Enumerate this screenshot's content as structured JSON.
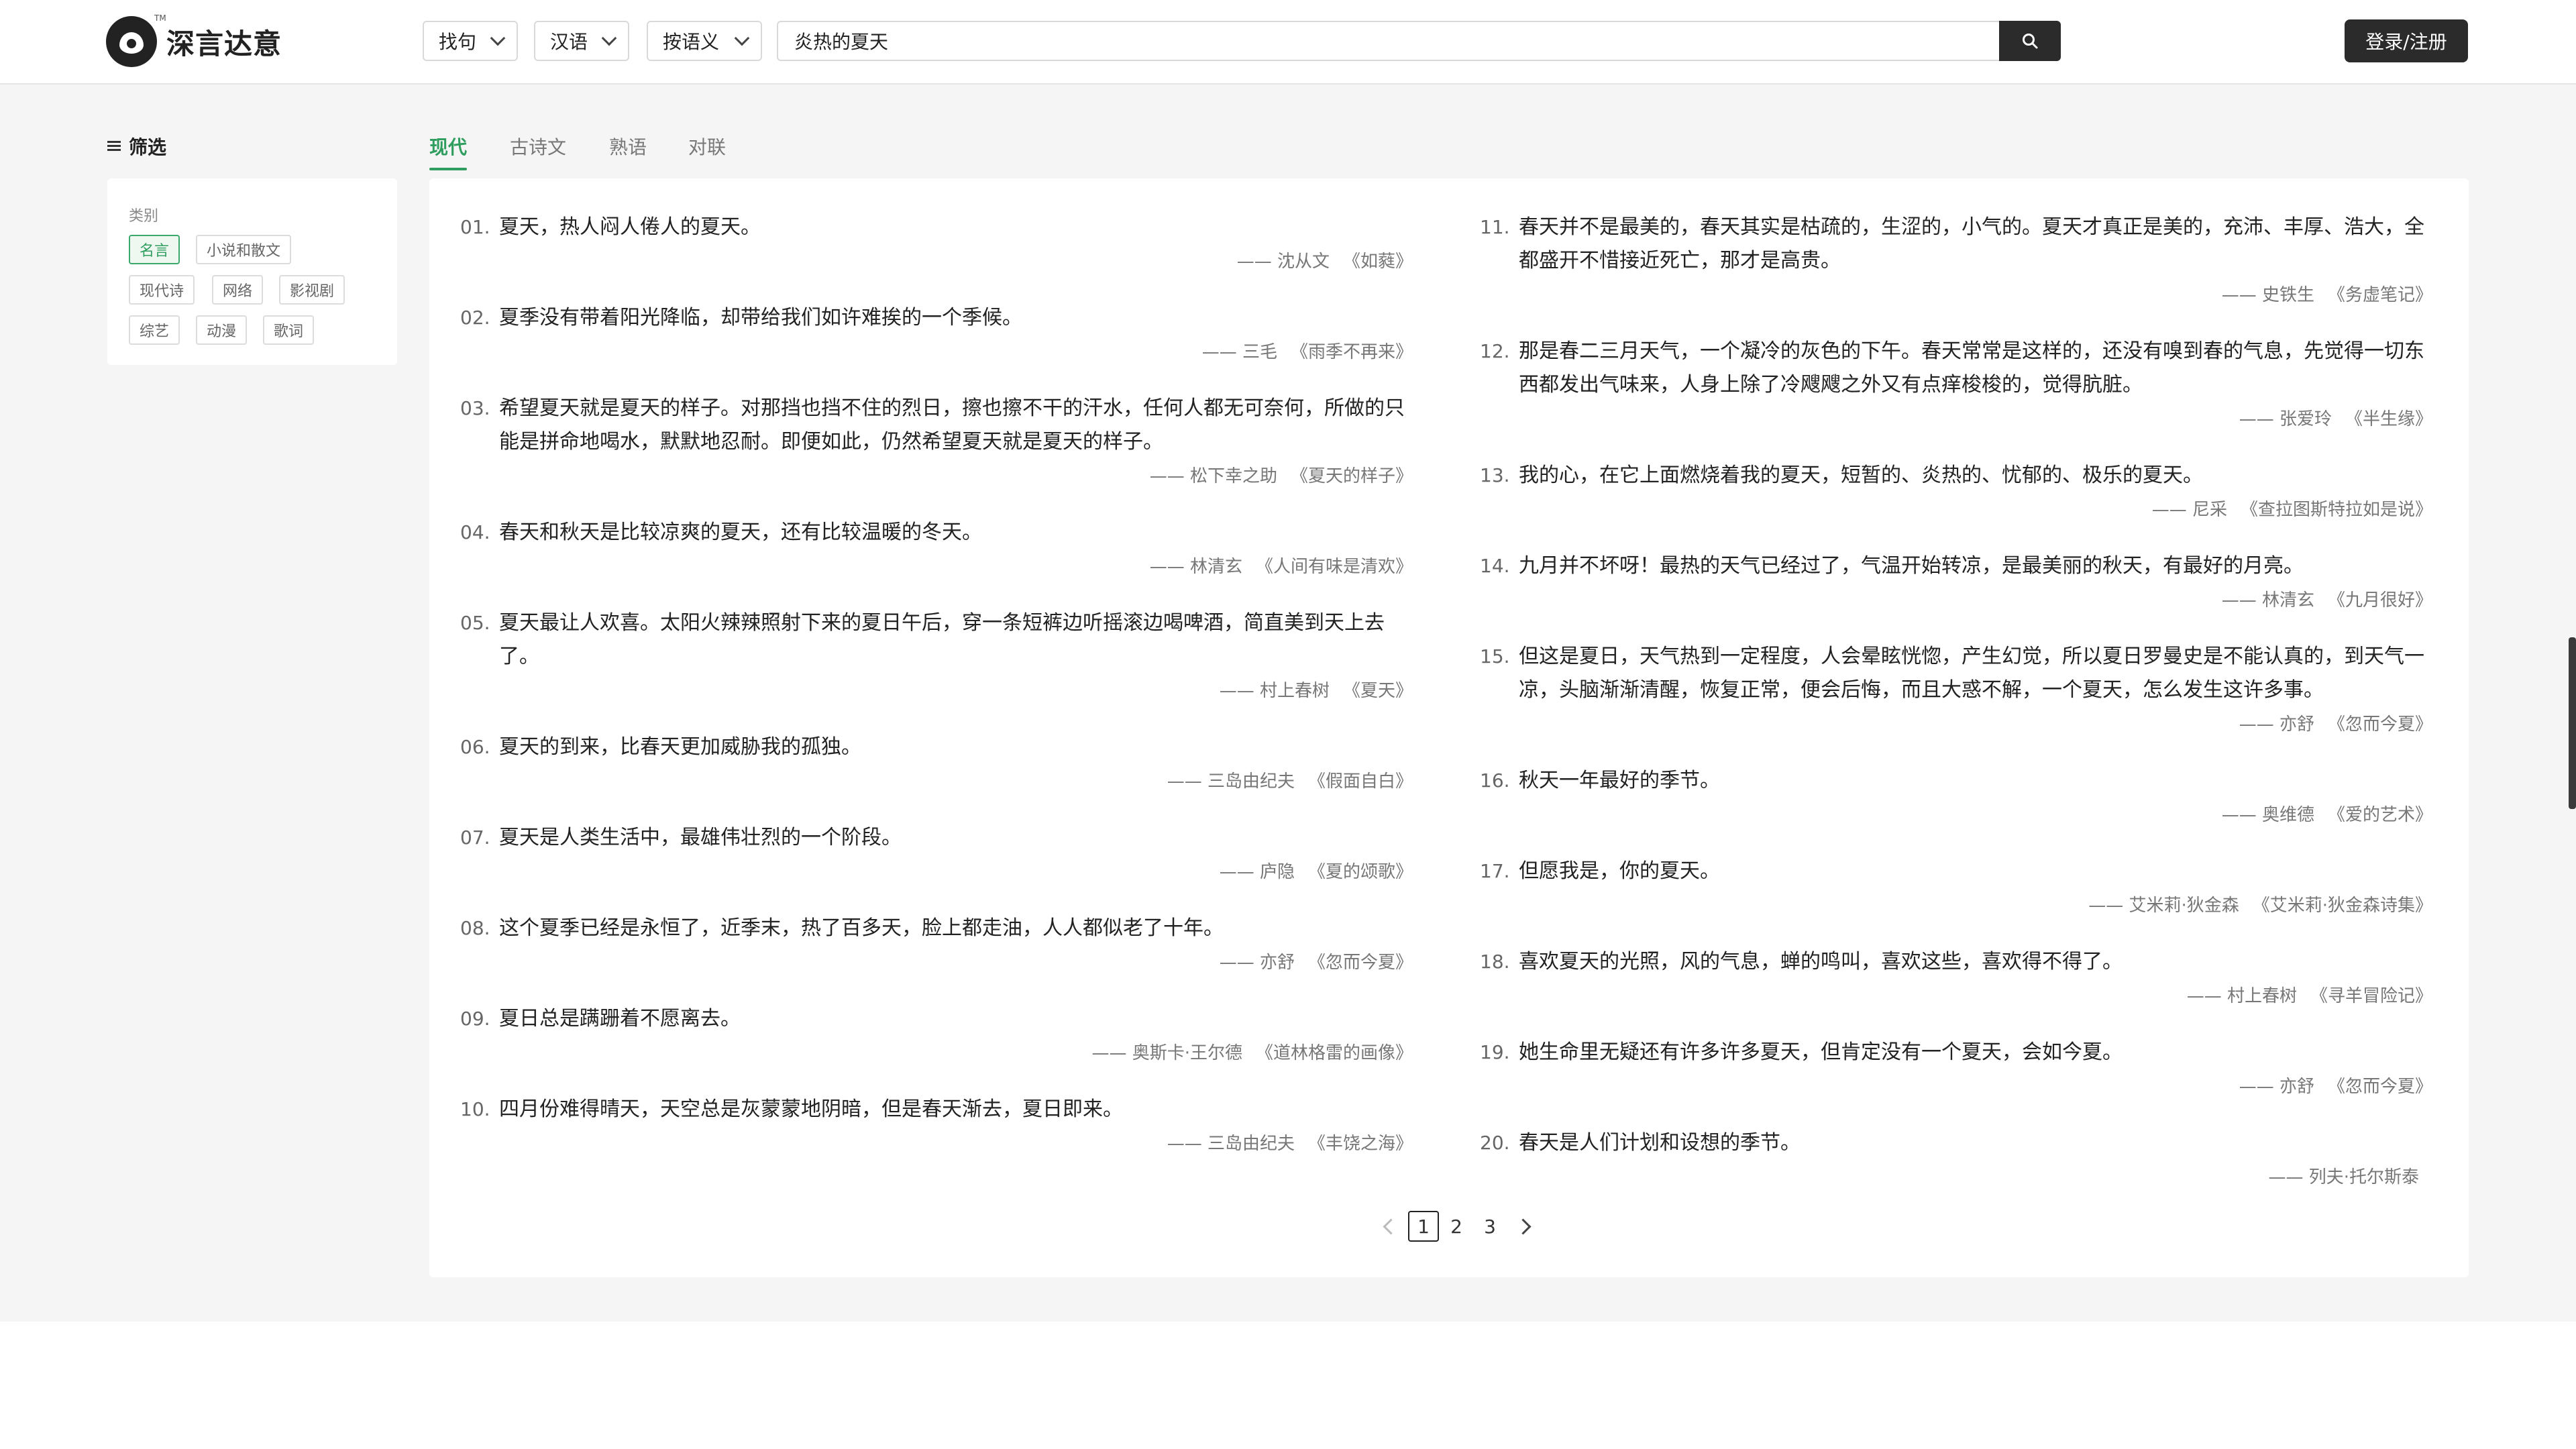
{
  "brand": {
    "name": "深言达意",
    "tm": "TM"
  },
  "header": {
    "mode_dropdown": "找句",
    "language_dropdown": "汉语",
    "method_dropdown": "按语义",
    "search_value": "炎热的夏天",
    "search_placeholder": "",
    "login_label": "登录/注册"
  },
  "sidebar": {
    "filter_title": "筛选",
    "category_label": "类别",
    "tags": [
      "名言",
      "小说和散文",
      "现代诗",
      "网络",
      "影视剧",
      "综艺",
      "动漫",
      "歌词"
    ],
    "active_tag": "名言"
  },
  "tabs": [
    "现代",
    "古诗文",
    "熟语",
    "对联"
  ],
  "active_tab": "现代",
  "quotes": [
    {
      "num": "01.",
      "text": "夏天，热人闷人倦人的夏天。",
      "author": "—— 沈从文",
      "book": "《如蕤》"
    },
    {
      "num": "02.",
      "text": "夏季没有带着阳光降临，却带给我们如许难挨的一个季候。",
      "author": "—— 三毛",
      "book": "《雨季不再来》"
    },
    {
      "num": "03.",
      "text": "希望夏天就是夏天的样子。对那挡也挡不住的烈日，擦也擦不干的汗水，任何人都无可奈何，所做的只能是拼命地喝水，默默地忍耐。即便如此，仍然希望夏天就是夏天的样子。",
      "author": "—— 松下幸之助",
      "book": "《夏天的样子》"
    },
    {
      "num": "04.",
      "text": "春天和秋天是比较凉爽的夏天，还有比较温暖的冬天。",
      "author": "—— 林清玄",
      "book": "《人间有味是清欢》"
    },
    {
      "num": "05.",
      "text": "夏天最让人欢喜。太阳火辣辣照射下来的夏日午后，穿一条短裤边听摇滚边喝啤酒，简直美到天上去了。",
      "author": "—— 村上春树",
      "book": "《夏天》"
    },
    {
      "num": "06.",
      "text": "夏天的到来，比春天更加威胁我的孤独。",
      "author": "—— 三岛由纪夫",
      "book": "《假面自白》"
    },
    {
      "num": "07.",
      "text": "夏天是人类生活中，最雄伟壮烈的一个阶段。",
      "author": "—— 庐隐",
      "book": "《夏的颂歌》"
    },
    {
      "num": "08.",
      "text": "这个夏季已经是永恒了，近季末，热了百多天，脸上都走油，人人都似老了十年。",
      "author": "—— 亦舒",
      "book": "《忽而今夏》"
    },
    {
      "num": "09.",
      "text": "夏日总是蹒跚着不愿离去。",
      "author": "—— 奥斯卡·王尔德",
      "book": "《道林格雷的画像》"
    },
    {
      "num": "10.",
      "text": "四月份难得晴天，天空总是灰蒙蒙地阴暗，但是春天渐去，夏日即来。",
      "author": "—— 三岛由纪夫",
      "book": "《丰饶之海》"
    },
    {
      "num": "11.",
      "text": "春天并不是最美的，春天其实是枯疏的，生涩的，小气的。夏天才真正是美的，充沛、丰厚、浩大，全都盛开不惜接近死亡，那才是高贵。",
      "author": "—— 史铁生",
      "book": "《务虚笔记》"
    },
    {
      "num": "12.",
      "text": "那是春二三月天气，一个凝冷的灰色的下午。春天常常是这样的，还没有嗅到春的气息，先觉得一切东西都发出气味来，人身上除了冷飕飕之外又有点痒梭梭的，觉得肮脏。",
      "author": "—— 张爱玲",
      "book": "《半生缘》"
    },
    {
      "num": "13.",
      "text": "我的心，在它上面燃烧着我的夏天，短暂的、炎热的、忧郁的、极乐的夏天。",
      "author": "—— 尼采",
      "book": "《查拉图斯特拉如是说》"
    },
    {
      "num": "14.",
      "text": "九月并不坏呀！最热的天气已经过了，气温开始转凉，是最美丽的秋天，有最好的月亮。",
      "author": "—— 林清玄",
      "book": "《九月很好》"
    },
    {
      "num": "15.",
      "text": "但这是夏日，天气热到一定程度，人会晕眩恍惚，产生幻觉，所以夏日罗曼史是不能认真的，到天气一凉，头脑渐渐清醒，恢复正常，便会后悔，而且大惑不解，一个夏天，怎么发生这许多事。",
      "author": "—— 亦舒",
      "book": "《忽而今夏》"
    },
    {
      "num": "16.",
      "text": "秋天一年最好的季节。",
      "author": "—— 奥维德",
      "book": "《爱的艺术》"
    },
    {
      "num": "17.",
      "text": "但愿我是，你的夏天。",
      "author": "—— 艾米莉·狄金森",
      "book": "《艾米莉·狄金森诗集》"
    },
    {
      "num": "18.",
      "text": "喜欢夏天的光照，风的气息，蝉的鸣叫，喜欢这些，喜欢得不得了。",
      "author": "—— 村上春树",
      "book": "《寻羊冒险记》"
    },
    {
      "num": "19.",
      "text": "她生命里无疑还有许多许多夏天，但肯定没有一个夏天，会如今夏。",
      "author": "—— 亦舒",
      "book": "《忽而今夏》"
    },
    {
      "num": "20.",
      "text": "春天是人们计划和设想的季节。",
      "author": "—— 列夫·托尔斯泰",
      "book": ""
    }
  ],
  "pagination": {
    "pages": [
      "1",
      "2",
      "3"
    ],
    "current": "1"
  },
  "colors": {
    "accent": "#2e9d5e",
    "dark": "#2b2b2b",
    "background": "#f5f5f5"
  },
  "icons": [
    "logo-icon",
    "chevron-down-icon",
    "search-icon",
    "menu-icon",
    "chevron-left-icon",
    "chevron-right-icon"
  ]
}
